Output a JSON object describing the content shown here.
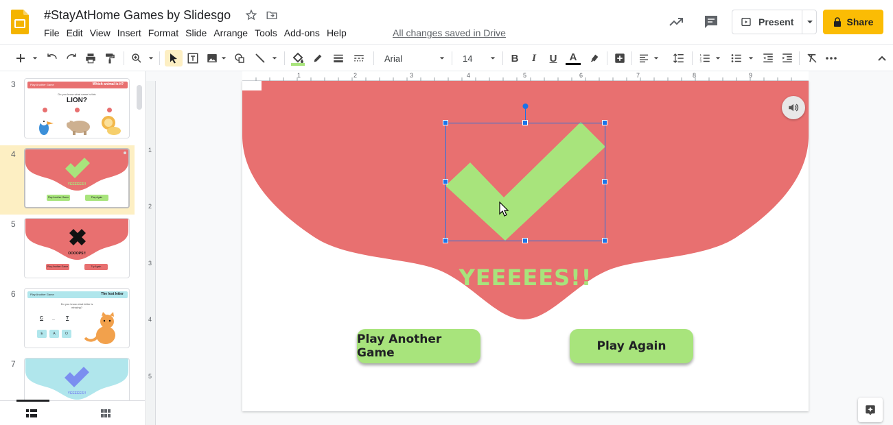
{
  "header": {
    "doc_title": "#StayAtHome Games by Slidesgo",
    "menu": [
      "File",
      "Edit",
      "View",
      "Insert",
      "Format",
      "Slide",
      "Arrange",
      "Tools",
      "Add-ons",
      "Help"
    ],
    "saved_status": "All changes saved in Drive",
    "present_label": "Present",
    "share_label": "Share"
  },
  "toolbar": {
    "font_name": "Arial",
    "font_size": "14",
    "bold": "B",
    "italic": "I",
    "underline": "U",
    "text_color": "A"
  },
  "filmstrip": {
    "slides": [
      {
        "number": "3",
        "header_left": "Play Another Game",
        "header_right": "Which animal is it?",
        "question": "Do you know what name is this",
        "answer": "LION?"
      },
      {
        "number": "4",
        "result": "YEEEEES!!",
        "btn1": "Play Another Game",
        "btn2": "Play Again"
      },
      {
        "number": "5",
        "result": "OOOOPS!!",
        "btn1": "Play Another Game",
        "btn2": "Try Again"
      },
      {
        "number": "6",
        "header_left": "Play Another Game",
        "header_right": "The lost letter",
        "question": "Do you know what letter is missing?",
        "letters": [
          "C",
          "_",
          "T"
        ],
        "choices": [
          "E",
          "A",
          "O"
        ]
      },
      {
        "number": "7",
        "result": "YEEEEES!!"
      }
    ]
  },
  "ruler": {
    "h_numbers": [
      "1",
      "2",
      "3",
      "4",
      "5",
      "6",
      "7",
      "8",
      "9"
    ],
    "v_numbers": [
      "1",
      "2",
      "3",
      "4",
      "5"
    ]
  },
  "slide": {
    "result_text": "YEEEEES!!",
    "button_left": "Play Another Game",
    "button_right": "Play Again"
  },
  "colors": {
    "blob": "#e87070",
    "green": "#a8e47c",
    "share": "#fbbc04",
    "selection": "#1a73e8",
    "blue_thumb": "#b0e6ec"
  }
}
